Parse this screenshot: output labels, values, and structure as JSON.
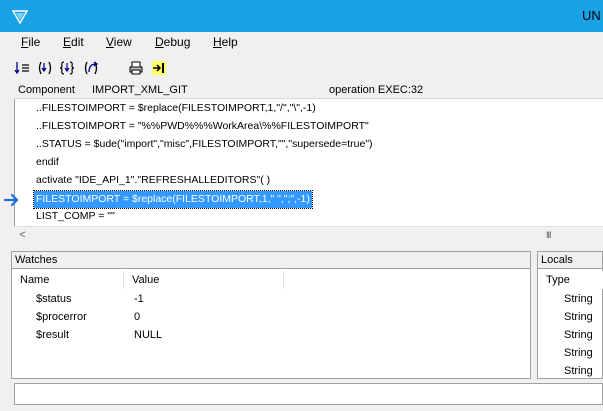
{
  "window": {
    "title": "UN"
  },
  "menu": [
    {
      "pre": "",
      "key": "F",
      "post": "ile"
    },
    {
      "pre": "",
      "key": "E",
      "post": "dit"
    },
    {
      "pre": "",
      "key": "V",
      "post": "iew"
    },
    {
      "pre": "",
      "key": "D",
      "post": "ebug"
    },
    {
      "pre": "",
      "key": "H",
      "post": "elp"
    }
  ],
  "toolbar": {
    "icons": [
      "step-over-icon",
      "step-into-icon",
      "step-into-braces-icon",
      "step-out-icon",
      "print-icon",
      "run-to-cursor-icon"
    ]
  },
  "header": {
    "component_label": "Component",
    "component_value": "IMPORT_XML_GIT",
    "operation": "operation EXEC:32"
  },
  "code": {
    "lines": [
      "..FILESTOIMPORT = $replace(FILESTOIMPORT,1,\"/\",\"\\\",-1)",
      "..FILESTOIMPORT = \"%%PWD%%%WorkArea\\%%FILESTOIMPORT\"",
      "..STATUS = $ude(\"import\",\"misc\",FILESTOIMPORT,\"\",\"supersede=true\")",
      "endif",
      "activate \"IDE_API_1\".\"REFRESHALLEDITORS\"(  )",
      "FILESTOIMPORT = $replace(FILESTOIMPORT,1,\" \",\";\",-1)",
      "LIST_COMP = \"\""
    ],
    "current_line_index": 5
  },
  "scrollbar": {
    "left_arrow": "<",
    "grip": "III"
  },
  "watches": {
    "title": "Watches",
    "columns": [
      "Name",
      "Value"
    ],
    "rows": [
      {
        "name": "$status",
        "value": "-1"
      },
      {
        "name": "$procerror",
        "value": "0"
      },
      {
        "name": "$result",
        "value": "NULL"
      }
    ]
  },
  "locals": {
    "title": "Locals",
    "columns": [
      "Type"
    ],
    "rows": [
      "String",
      "String",
      "String",
      "String",
      "String"
    ]
  }
}
